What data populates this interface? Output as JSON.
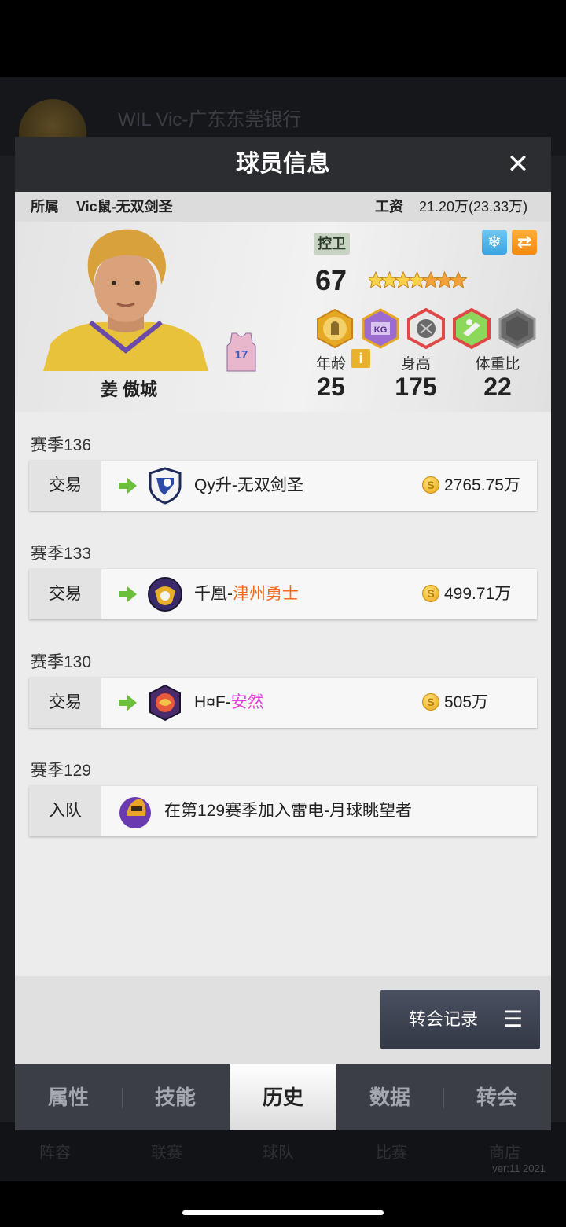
{
  "background": {
    "title": "WIL Vic-广东东莞银行",
    "tabs": [
      "阵容",
      "联赛",
      "球队",
      "比赛",
      "商店"
    ],
    "version": "ver:11  2021"
  },
  "modal": {
    "title": "球员信息",
    "close_label": "✕"
  },
  "info_bar": {
    "team_label": "所属",
    "team_value": "Vic鼠-无双剑圣",
    "salary_label": "工资",
    "salary_value": "21.20万(23.33万)"
  },
  "player": {
    "name": "姜 傲城",
    "jersey_number": "17",
    "position": "控卫",
    "rating": "67",
    "stars": 7,
    "age_label": "年龄",
    "age_value": "25",
    "height_label": "身高",
    "height_value": "175",
    "weight_label": "体重比",
    "weight_value": "22",
    "badges": [
      "trophy-badge",
      "kg-badge",
      "ball-badge",
      "wrench-badge",
      "locked-badge"
    ]
  },
  "history": [
    {
      "season": "赛季136",
      "type": "交易",
      "team_prefix": "Qy升-",
      "team_suffix": "无双剑圣",
      "suffix_color": "default",
      "price": "2765.75万"
    },
    {
      "season": "赛季133",
      "type": "交易",
      "team_prefix": "千凰-",
      "team_suffix": "津州勇士",
      "suffix_color": "#f26a1b",
      "price": "499.71万"
    },
    {
      "season": "赛季130",
      "type": "交易",
      "team_prefix": "H¤F-",
      "team_suffix": "安然",
      "suffix_color": "#e63ed6",
      "price": "505万"
    },
    {
      "season": "赛季129",
      "type": "入队",
      "description": "在第129赛季加入雷电-月球眺望者"
    }
  ],
  "transfer_button": {
    "label": "转会记录",
    "menu_icon": "☰"
  },
  "tabs": [
    {
      "label": "属性",
      "active": false
    },
    {
      "label": "技能",
      "active": false
    },
    {
      "label": "历史",
      "active": true
    },
    {
      "label": "数据",
      "active": false
    },
    {
      "label": "转会",
      "active": false
    }
  ],
  "colors": {
    "header": "#2b2d31",
    "tab_bar": "#3b3e44",
    "accent_orange": "#f26a1b",
    "accent_pink": "#e63ed6",
    "arrow_green": "#6cbf3a"
  }
}
